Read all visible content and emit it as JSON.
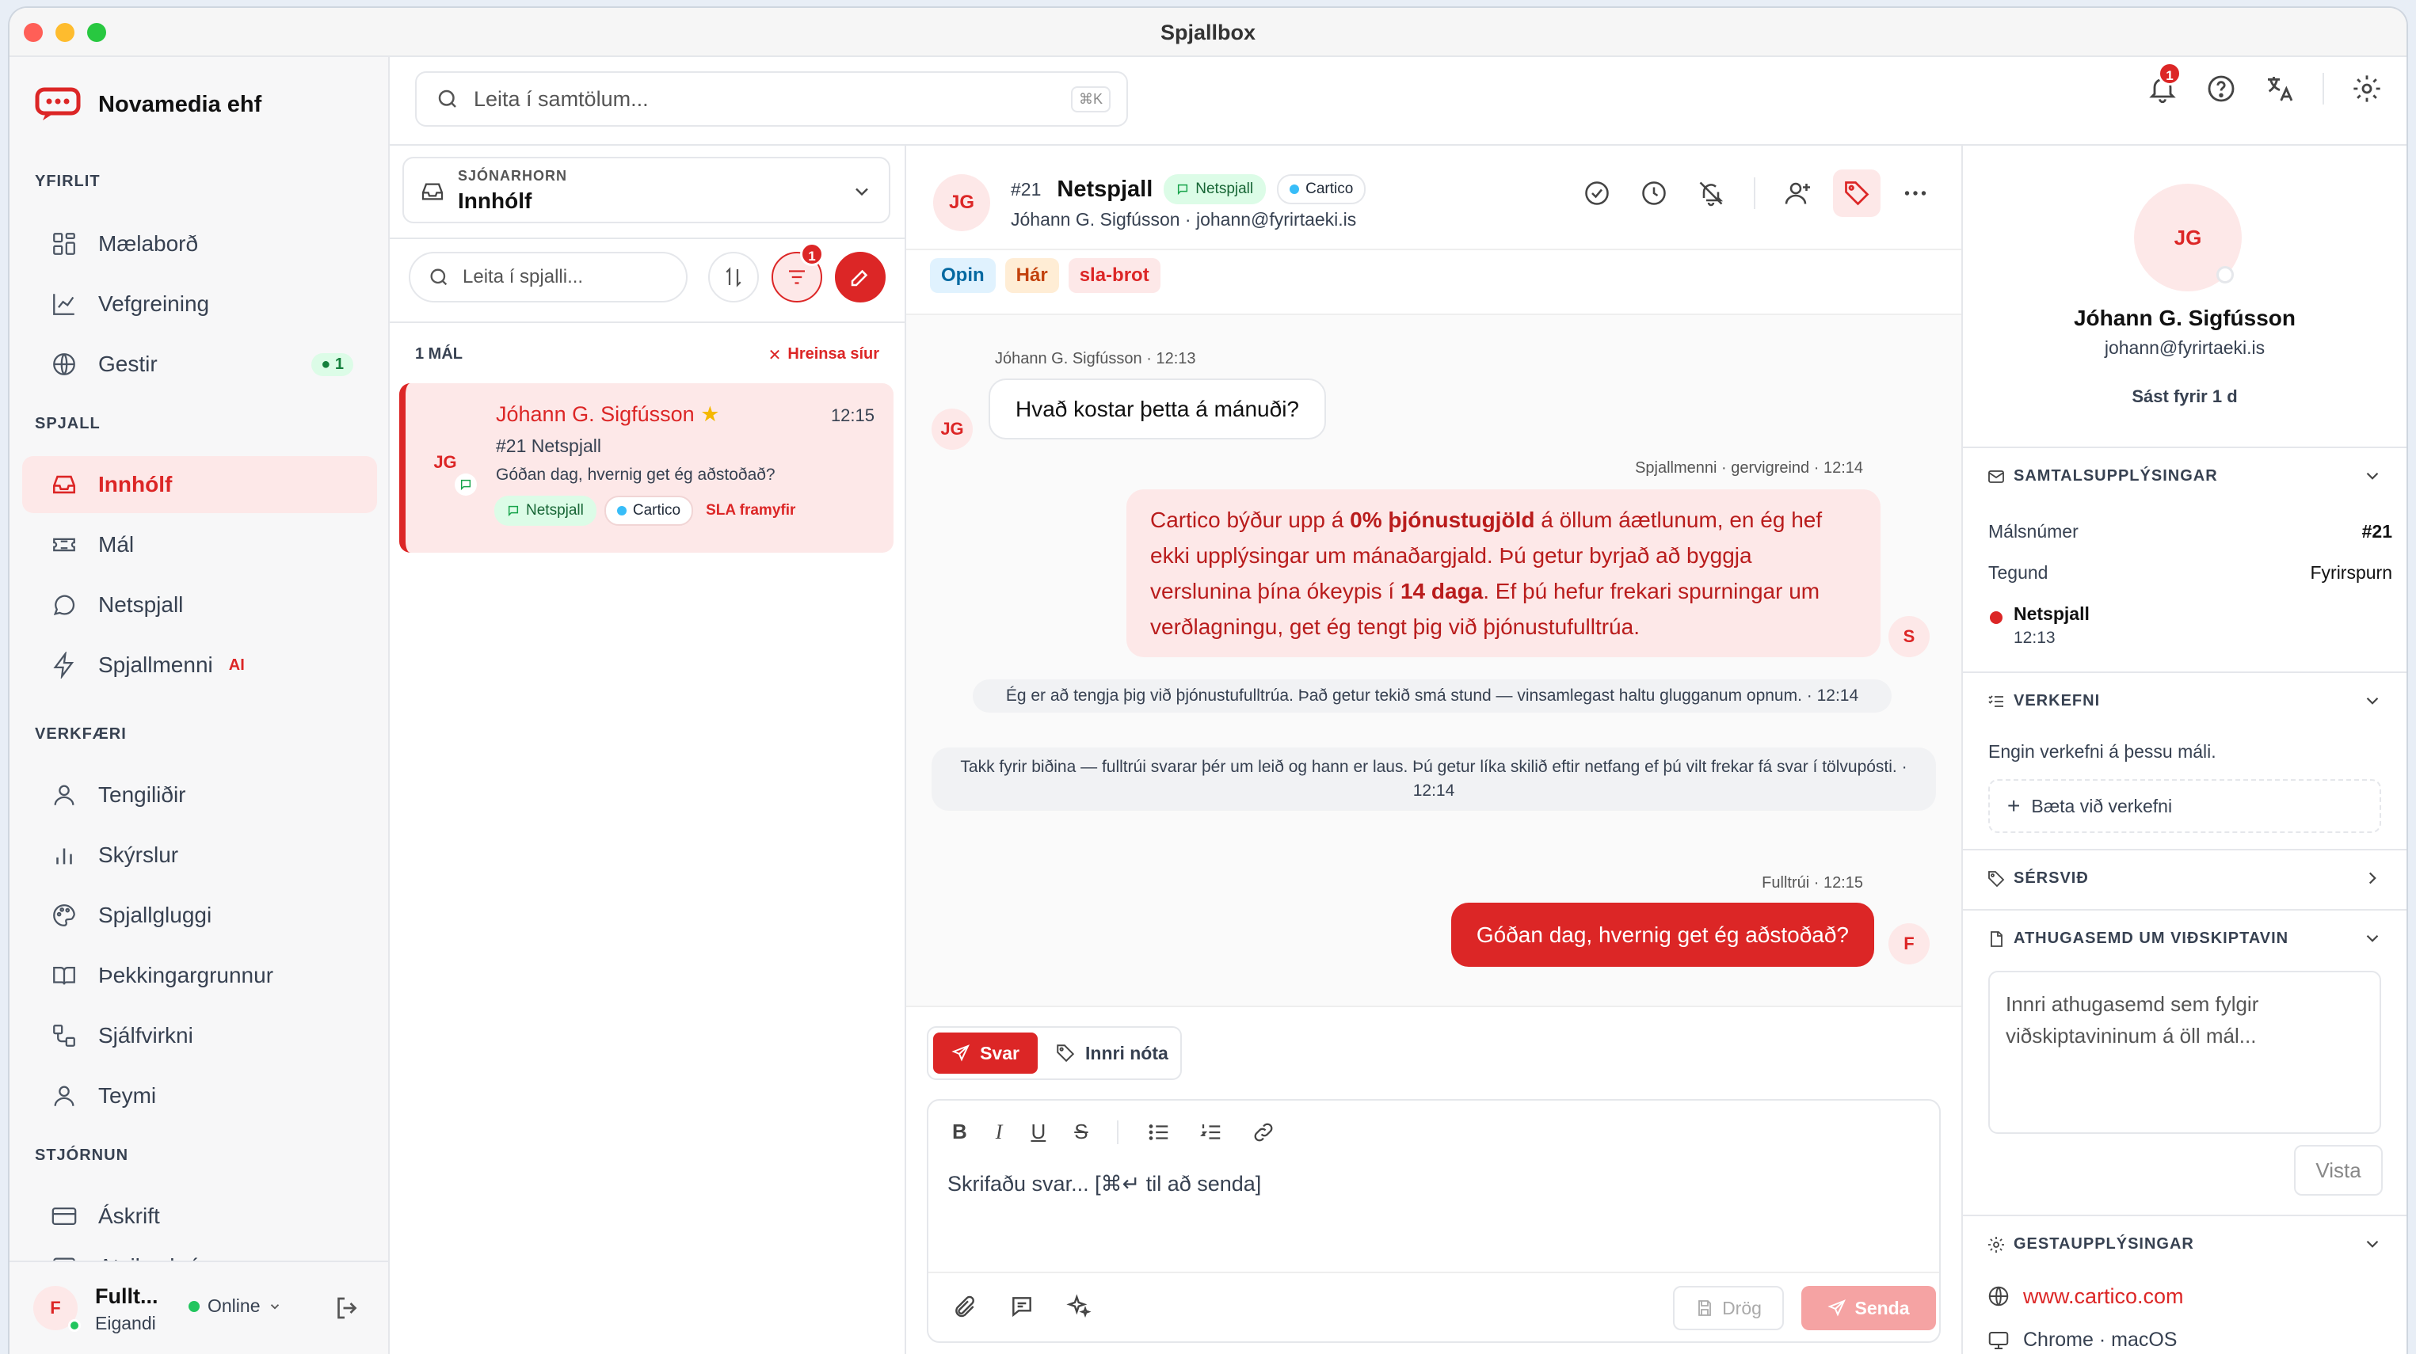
{
  "window": {
    "title": "Spjallbox"
  },
  "brand": {
    "name": "Novamedia ehf"
  },
  "nav": {
    "sections": [
      "YFIRLIT",
      "SPJALL",
      "VERKFÆRI",
      "STJÓRNUN"
    ],
    "items": [
      {
        "label": "Mælaborð"
      },
      {
        "label": "Vefgreining"
      },
      {
        "label": "Gestir",
        "badge": "1"
      },
      {
        "label": "Innhólf"
      },
      {
        "label": "Mál"
      },
      {
        "label": "Netspjall"
      },
      {
        "label": "Spjallmenni",
        "badge": "AI"
      },
      {
        "label": "Tengiliðir"
      },
      {
        "label": "Skýrslur"
      },
      {
        "label": "Spjallgluggi"
      },
      {
        "label": "Þekkingargrunnur"
      },
      {
        "label": "Sjálfvirkni"
      },
      {
        "label": "Teymi"
      },
      {
        "label": "Áskrift"
      },
      {
        "label": "Atvikaskrá"
      }
    ]
  },
  "user": {
    "initial": "F",
    "name": "Fullt...",
    "role": "Eigandi",
    "status": "Online"
  },
  "search": {
    "placeholder": "Leita í samtölum...",
    "shortcut": "⌘K"
  },
  "notifications": {
    "count": "1"
  },
  "inbox": {
    "view_label": "SJÓNARHORN",
    "view_value": "Innhólf",
    "search_placeholder": "Leita í spjalli...",
    "filter_badge": "1",
    "count_label": "1 MÁL",
    "clear_label": "Hreinsa síur",
    "conversation": {
      "initials": "JG",
      "name": "Jóhann G. Sigfússon",
      "time": "12:15",
      "ticket": "#21",
      "channel": "Netspjall",
      "preview": "Góðan dag, hvernig get ég aðstoðað?",
      "chips": [
        "Netspjall",
        "Cartico"
      ],
      "sla": "SLA framyfir"
    }
  },
  "chat": {
    "initials": "JG",
    "ticket": "#21",
    "title": "Netspjall",
    "chips": [
      "Netspjall",
      "Cartico"
    ],
    "subtitle": "Jóhann G. Sigfússon · johann@fyrirtaeki.is",
    "tags": [
      "Opin",
      "Hár",
      "sla-brot"
    ],
    "messages": {
      "m1_meta": "Jóhann G. Sigfússon · 12:13",
      "m1_text": "Hvað kostar þetta á mánuði?",
      "m1_av": "JG",
      "m2_meta": "Spjallmenni · gervigreind · 12:14",
      "m2_av": "S",
      "m2_parts": [
        "Cartico býður upp á ",
        "0% þjónustugjöld",
        " á öllum áætlunum, en ég hef ekki upplýsingar um mánaðargjald. Þú getur byrjað að byggja verslunina þína ókeypis í ",
        "14 daga",
        ". Ef þú hefur frekari spurningar um verðlagningu, get ég tengt þig við þjónustufulltrúa."
      ],
      "sys1": "Ég er að tengja þig við þjónustufulltrúa. Það getur tekið smá stund — vinsamlegast haltu glugganum opnum. · 12:14",
      "sys2": "Takk fyrir biðina — fulltrúi svarar þér um leið og hann er laus. Þú getur líka skilið eftir netfang ef þú vilt frekar fá svar í tölvupósti. ·",
      "sys2_time": "12:14",
      "m3_meta": "Fulltrúi · 12:15",
      "m3_text": "Góðan dag, hvernig get ég aðstoðað?",
      "m3_av": "F"
    },
    "composer": {
      "tab_reply": "Svar",
      "tab_note": "Innri nóta",
      "placeholder": "Skrifaðu svar... [⌘↵ til að senda]",
      "draft": "Drög",
      "send": "Senda"
    }
  },
  "profile": {
    "initials": "JG",
    "name": "Jóhann G. Sigfússon",
    "email": "johann@fyrirtaeki.is",
    "last_seen": "Sást fyrir 1 d",
    "sections": {
      "info": {
        "title": "SAMTALSUPPLÝSINGAR",
        "case_label": "Málsnúmer",
        "case_value": "#21",
        "type_label": "Tegund",
        "type_value": "Fyrirspurn",
        "channel": "Netspjall",
        "channel_time": "12:13"
      },
      "tasks": {
        "title": "VERKEFNI",
        "empty": "Engin verkefni á þessu máli.",
        "add": "Bæta við verkefni"
      },
      "custom": {
        "title": "SÉRSVIÐ"
      },
      "note": {
        "title": "ATHUGASEMD UM VIÐSKIPTAVIN",
        "placeholder": "Innri athugasemd sem fylgir viðskiptavininum á öll mál...",
        "save": "Vista"
      },
      "visitor": {
        "title": "GESTAUPPLÝSINGAR",
        "url": "www.cartico.com",
        "browser": "Chrome · macOS"
      }
    }
  },
  "colors": {
    "accent": "#dc2626",
    "accent_soft": "#fde8e8",
    "online": "#22c55e",
    "cartico_dot": "#38bdf8"
  }
}
